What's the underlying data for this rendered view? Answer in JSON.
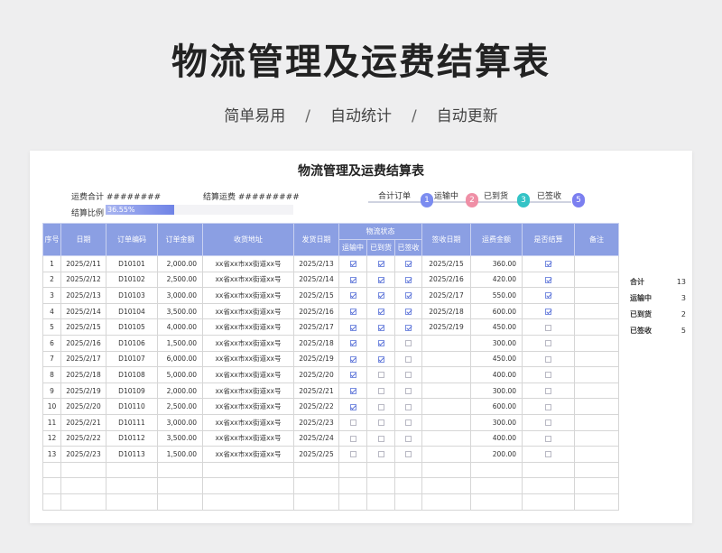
{
  "header": {
    "title": "物流管理及运费结算表",
    "subtitle": [
      "简单易用",
      "自动统计",
      "自动更新"
    ],
    "separator": "/"
  },
  "sheet": {
    "title": "物流管理及运费结算表",
    "summary": [
      {
        "label": "运费合计",
        "value": "########"
      },
      {
        "label": "结算运费",
        "value": "#########"
      }
    ],
    "ratio": {
      "label": "结算比例",
      "value": "36.55%",
      "fraction": 0.3655
    },
    "flow": [
      {
        "label": "合计订单",
        "num": "1",
        "color": "#7b8cf0"
      },
      {
        "label": "运输中",
        "num": "2",
        "color": "#ef8fa6"
      },
      {
        "label": "已到货",
        "num": "3",
        "color": "#33c3c6"
      },
      {
        "label": "已签收",
        "num": "5",
        "color": "#7b7ff0"
      }
    ],
    "columns": [
      "序号",
      "日期",
      "订单编码",
      "订单金额",
      "收货地址",
      "发货日期",
      "物流状态",
      "签收日期",
      "运费金额",
      "是否结算",
      "备注"
    ],
    "status_columns": [
      "运输中",
      "已到货",
      "已签收"
    ],
    "rows": [
      {
        "no": "1",
        "date": "2025/2/11",
        "code": "D10101",
        "amount": "2,000.00",
        "addr": "xx省xx市xx街道xx号",
        "ship": "2025/2/13",
        "s1": true,
        "s2": true,
        "s3": true,
        "sign": "2025/2/15",
        "fee": "360.00",
        "settled": true
      },
      {
        "no": "2",
        "date": "2025/2/12",
        "code": "D10102",
        "amount": "2,500.00",
        "addr": "xx省xx市xx街道xx号",
        "ship": "2025/2/14",
        "s1": true,
        "s2": true,
        "s3": true,
        "sign": "2025/2/16",
        "fee": "420.00",
        "settled": true
      },
      {
        "no": "3",
        "date": "2025/2/13",
        "code": "D10103",
        "amount": "3,000.00",
        "addr": "xx省xx市xx街道xx号",
        "ship": "2025/2/15",
        "s1": true,
        "s2": true,
        "s3": true,
        "sign": "2025/2/17",
        "fee": "550.00",
        "settled": true
      },
      {
        "no": "4",
        "date": "2025/2/14",
        "code": "D10104",
        "amount": "3,500.00",
        "addr": "xx省xx市xx街道xx号",
        "ship": "2025/2/16",
        "s1": true,
        "s2": true,
        "s3": true,
        "sign": "2025/2/18",
        "fee": "600.00",
        "settled": true
      },
      {
        "no": "5",
        "date": "2025/2/15",
        "code": "D10105",
        "amount": "4,000.00",
        "addr": "xx省xx市xx街道xx号",
        "ship": "2025/2/17",
        "s1": true,
        "s2": true,
        "s3": true,
        "sign": "2025/2/19",
        "fee": "450.00",
        "settled": false
      },
      {
        "no": "6",
        "date": "2025/2/16",
        "code": "D10106",
        "amount": "1,500.00",
        "addr": "xx省xx市xx街道xx号",
        "ship": "2025/2/18",
        "s1": true,
        "s2": true,
        "s3": false,
        "sign": "",
        "fee": "300.00",
        "settled": false
      },
      {
        "no": "7",
        "date": "2025/2/17",
        "code": "D10107",
        "amount": "6,000.00",
        "addr": "xx省xx市xx街道xx号",
        "ship": "2025/2/19",
        "s1": true,
        "s2": true,
        "s3": false,
        "sign": "",
        "fee": "450.00",
        "settled": false
      },
      {
        "no": "8",
        "date": "2025/2/18",
        "code": "D10108",
        "amount": "5,000.00",
        "addr": "xx省xx市xx街道xx号",
        "ship": "2025/2/20",
        "s1": true,
        "s2": false,
        "s3": false,
        "sign": "",
        "fee": "400.00",
        "settled": false
      },
      {
        "no": "9",
        "date": "2025/2/19",
        "code": "D10109",
        "amount": "2,000.00",
        "addr": "xx省xx市xx街道xx号",
        "ship": "2025/2/21",
        "s1": true,
        "s2": false,
        "s3": false,
        "sign": "",
        "fee": "300.00",
        "settled": false
      },
      {
        "no": "10",
        "date": "2025/2/20",
        "code": "D10110",
        "amount": "2,500.00",
        "addr": "xx省xx市xx街道xx号",
        "ship": "2025/2/22",
        "s1": true,
        "s2": false,
        "s3": false,
        "sign": "",
        "fee": "600.00",
        "settled": false
      },
      {
        "no": "11",
        "date": "2025/2/21",
        "code": "D10111",
        "amount": "3,000.00",
        "addr": "xx省xx市xx街道xx号",
        "ship": "2025/2/23",
        "s1": false,
        "s2": false,
        "s3": false,
        "sign": "",
        "fee": "300.00",
        "settled": false
      },
      {
        "no": "12",
        "date": "2025/2/22",
        "code": "D10112",
        "amount": "3,500.00",
        "addr": "xx省xx市xx街道xx号",
        "ship": "2025/2/24",
        "s1": false,
        "s2": false,
        "s3": false,
        "sign": "",
        "fee": "400.00",
        "settled": false
      },
      {
        "no": "13",
        "date": "2025/2/23",
        "code": "D10113",
        "amount": "1,500.00",
        "addr": "xx省xx市xx街道xx号",
        "ship": "2025/2/25",
        "s1": false,
        "s2": false,
        "s3": false,
        "sign": "",
        "fee": "200.00",
        "settled": false
      }
    ],
    "stats": [
      {
        "label": "合计",
        "value": "13"
      },
      {
        "label": "运输中",
        "value": "3"
      },
      {
        "label": "已到货",
        "value": "2"
      },
      {
        "label": "已签收",
        "value": "5"
      }
    ]
  },
  "colors": {
    "header_bg": "#8b9fe3",
    "accent": "#6f83e6"
  }
}
